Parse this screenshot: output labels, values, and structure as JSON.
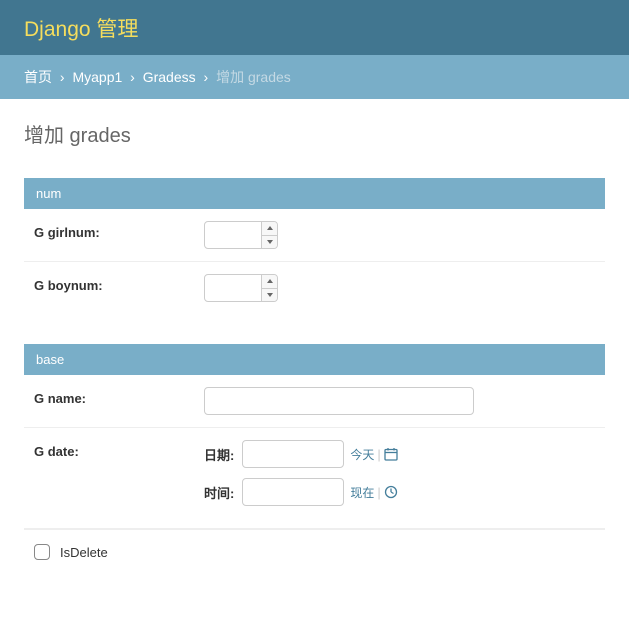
{
  "header": {
    "title": "Django 管理"
  },
  "breadcrumbs": {
    "home": "首页",
    "app": "Myapp1",
    "model": "Gradess",
    "current": "增加 grades"
  },
  "page": {
    "title": "增加 grades"
  },
  "fieldsets": {
    "num": {
      "legend": "num",
      "girlnum_label": "G girlnum:",
      "girlnum_value": "",
      "boynum_label": "G boynum:",
      "boynum_value": ""
    },
    "base": {
      "legend": "base",
      "name_label": "G name:",
      "name_value": "",
      "date_label": "G date:",
      "date_sub_label": "日期:",
      "date_value": "",
      "date_shortcut": "今天",
      "time_sub_label": "时间:",
      "time_value": "",
      "time_shortcut": "现在",
      "isdelete_label": "IsDelete"
    }
  }
}
